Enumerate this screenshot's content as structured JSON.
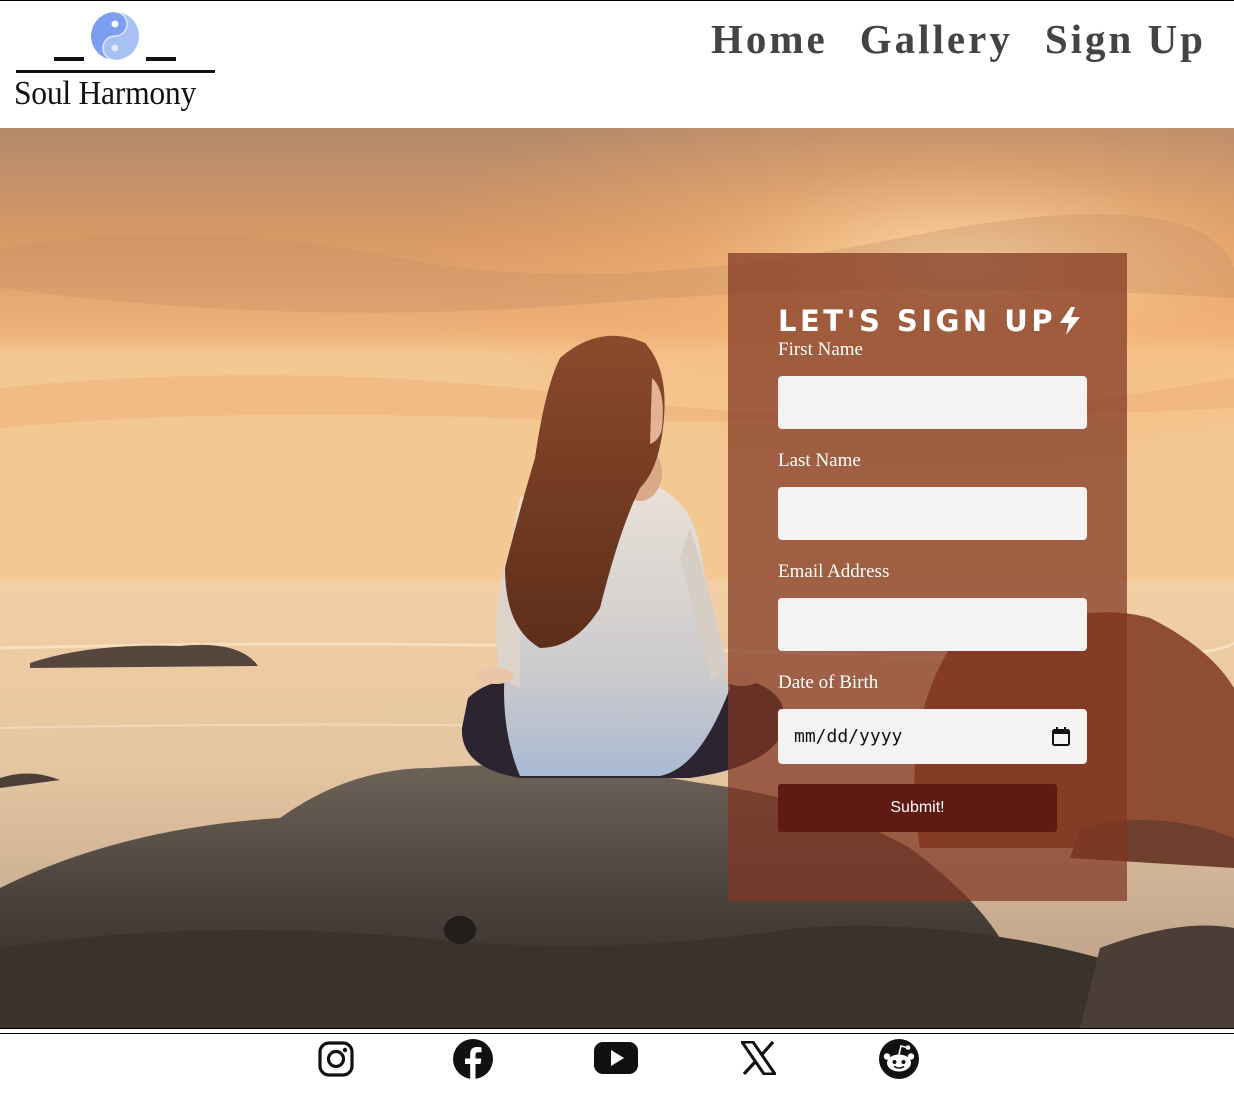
{
  "header": {
    "logo_text": "Soul Harmony",
    "nav": [
      {
        "label": "Home"
      },
      {
        "label": "Gallery"
      },
      {
        "label": "Sign Up"
      }
    ]
  },
  "form": {
    "title": "LET'S SIGN UP",
    "title_icon": "lightning-bolt-icon",
    "fields": [
      {
        "label": "First Name",
        "value": "",
        "type": "text"
      },
      {
        "label": "Last Name",
        "value": "",
        "type": "text"
      },
      {
        "label": "Email Address",
        "value": "",
        "type": "email"
      },
      {
        "label": "Date of Birth",
        "value": "mm/dd/yyyy",
        "type": "date"
      }
    ],
    "submit_label": "Submit!"
  },
  "footer": {
    "social_icons": [
      "instagram-icon",
      "facebook-icon",
      "youtube-icon",
      "x-twitter-icon",
      "reddit-icon"
    ]
  },
  "colors": {
    "logo_accent": "#7c9ef0",
    "nav_text": "#444444",
    "panel_bg": "#803622",
    "submit_bg": "#5f1a13",
    "input_bg": "#f3f3f3"
  }
}
